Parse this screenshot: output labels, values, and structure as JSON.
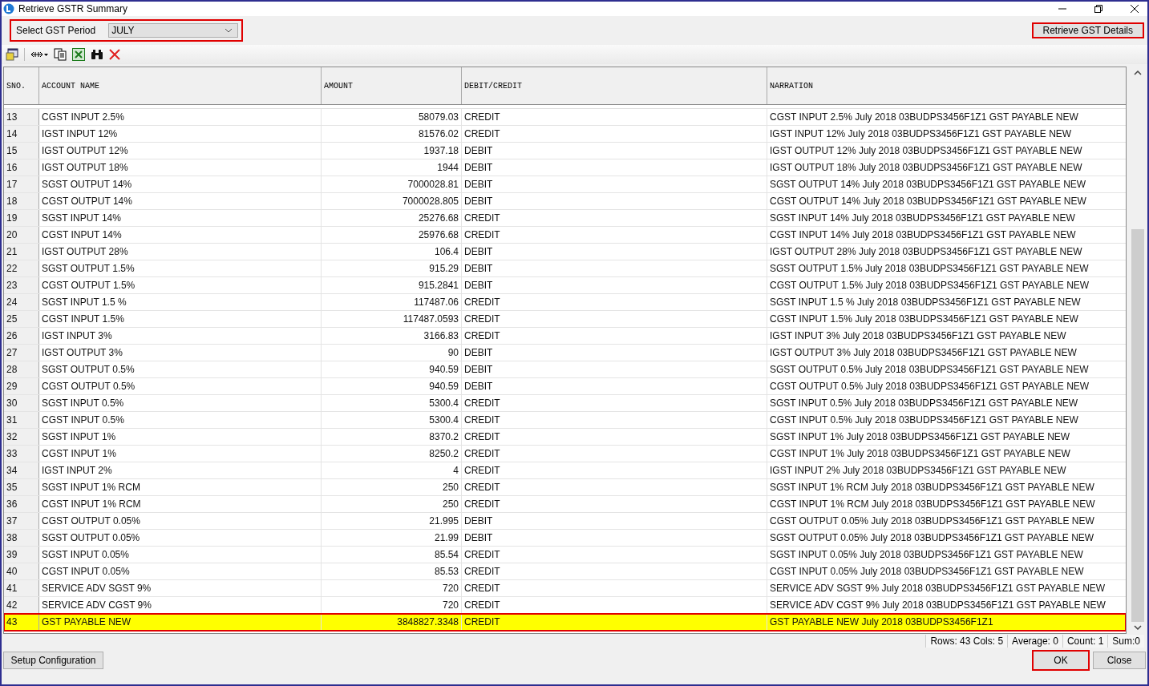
{
  "window": {
    "title": "Retrieve GSTR Summary"
  },
  "period": {
    "label": "Select GST Period",
    "value": "JULY",
    "highlighted": true
  },
  "retrieve_button": {
    "label": "Retrieve GST Details",
    "highlighted": true
  },
  "table": {
    "columns": [
      "SNO.",
      "ACCOUNT NAME",
      "AMOUNT",
      "DEBIT/CREDIT",
      "NARRATION"
    ],
    "rows": [
      {
        "sno": "13",
        "account": "CGST INPUT 2.5%",
        "amount": "58079.03",
        "dc": "CREDIT",
        "narration": "CGST INPUT 2.5% July 2018 03BUDPS3456F1Z1 GST PAYABLE NEW",
        "selected": false,
        "highlighted": false
      },
      {
        "sno": "14",
        "account": "IGST INPUT 12%",
        "amount": "81576.02",
        "dc": "CREDIT",
        "narration": "IGST INPUT 12% July 2018 03BUDPS3456F1Z1 GST PAYABLE NEW",
        "selected": false,
        "highlighted": false
      },
      {
        "sno": "15",
        "account": "IGST OUTPUT 12%",
        "amount": "1937.18",
        "dc": "DEBIT",
        "narration": "IGST OUTPUT 12% July 2018 03BUDPS3456F1Z1 GST PAYABLE NEW",
        "selected": false,
        "highlighted": false
      },
      {
        "sno": "16",
        "account": "IGST OUTPUT 18%",
        "amount": "1944",
        "dc": "DEBIT",
        "narration": "IGST OUTPUT 18% July 2018 03BUDPS3456F1Z1 GST PAYABLE NEW",
        "selected": false,
        "highlighted": false
      },
      {
        "sno": "17",
        "account": "SGST OUTPUT 14%",
        "amount": "7000028.81",
        "dc": "DEBIT",
        "narration": "SGST OUTPUT 14% July 2018 03BUDPS3456F1Z1 GST PAYABLE NEW",
        "selected": false,
        "highlighted": false
      },
      {
        "sno": "18",
        "account": "CGST OUTPUT 14%",
        "amount": "7000028.805",
        "dc": "DEBIT",
        "narration": "CGST OUTPUT 14% July 2018 03BUDPS3456F1Z1 GST PAYABLE NEW",
        "selected": false,
        "highlighted": false
      },
      {
        "sno": "19",
        "account": "SGST INPUT 14%",
        "amount": "25276.68",
        "dc": "CREDIT",
        "narration": "SGST INPUT 14% July 2018 03BUDPS3456F1Z1 GST PAYABLE NEW",
        "selected": false,
        "highlighted": false
      },
      {
        "sno": "20",
        "account": "CGST INPUT 14%",
        "amount": "25976.68",
        "dc": "CREDIT",
        "narration": "CGST INPUT 14% July 2018 03BUDPS3456F1Z1 GST PAYABLE NEW",
        "selected": false,
        "highlighted": false
      },
      {
        "sno": "21",
        "account": "IGST OUTPUT 28%",
        "amount": "106.4",
        "dc": "DEBIT",
        "narration": "IGST OUTPUT 28% July 2018 03BUDPS3456F1Z1 GST PAYABLE NEW",
        "selected": false,
        "highlighted": false
      },
      {
        "sno": "22",
        "account": "SGST OUTPUT 1.5%",
        "amount": "915.29",
        "dc": "DEBIT",
        "narration": "SGST OUTPUT 1.5% July 2018 03BUDPS3456F1Z1 GST PAYABLE NEW",
        "selected": false,
        "highlighted": false
      },
      {
        "sno": "23",
        "account": "CGST OUTPUT 1.5%",
        "amount": "915.2841",
        "dc": "DEBIT",
        "narration": "CGST OUTPUT 1.5% July 2018 03BUDPS3456F1Z1 GST PAYABLE NEW",
        "selected": false,
        "highlighted": false
      },
      {
        "sno": "24",
        "account": "SGST INPUT 1.5 %",
        "amount": "117487.06",
        "dc": "CREDIT",
        "narration": "SGST INPUT 1.5 % July 2018 03BUDPS3456F1Z1 GST PAYABLE NEW",
        "selected": false,
        "highlighted": false
      },
      {
        "sno": "25",
        "account": "CGST INPUT 1.5%",
        "amount": "117487.0593",
        "dc": "CREDIT",
        "narration": "CGST INPUT 1.5% July 2018 03BUDPS3456F1Z1 GST PAYABLE NEW",
        "selected": false,
        "highlighted": false
      },
      {
        "sno": "26",
        "account": "IGST INPUT 3%",
        "amount": "3166.83",
        "dc": "CREDIT",
        "narration": "IGST INPUT 3% July 2018 03BUDPS3456F1Z1 GST PAYABLE NEW",
        "selected": false,
        "highlighted": false
      },
      {
        "sno": "27",
        "account": "IGST OUTPUT 3%",
        "amount": "90",
        "dc": "DEBIT",
        "narration": "IGST OUTPUT 3% July 2018 03BUDPS3456F1Z1 GST PAYABLE NEW",
        "selected": false,
        "highlighted": false
      },
      {
        "sno": "28",
        "account": "SGST OUTPUT 0.5%",
        "amount": "940.59",
        "dc": "DEBIT",
        "narration": "SGST OUTPUT 0.5% July 2018 03BUDPS3456F1Z1 GST PAYABLE NEW",
        "selected": false,
        "highlighted": false
      },
      {
        "sno": "29",
        "account": "CGST OUTPUT 0.5%",
        "amount": "940.59",
        "dc": "DEBIT",
        "narration": "CGST OUTPUT 0.5% July 2018 03BUDPS3456F1Z1 GST PAYABLE NEW",
        "selected": false,
        "highlighted": false
      },
      {
        "sno": "30",
        "account": "SGST INPUT 0.5%",
        "amount": "5300.4",
        "dc": "CREDIT",
        "narration": "SGST INPUT 0.5% July 2018 03BUDPS3456F1Z1 GST PAYABLE NEW",
        "selected": false,
        "highlighted": false
      },
      {
        "sno": "31",
        "account": "CGST INPUT 0.5%",
        "amount": "5300.4",
        "dc": "CREDIT",
        "narration": "CGST INPUT 0.5% July 2018 03BUDPS3456F1Z1 GST PAYABLE NEW",
        "selected": false,
        "highlighted": false
      },
      {
        "sno": "32",
        "account": "SGST INPUT 1%",
        "amount": "8370.2",
        "dc": "CREDIT",
        "narration": "SGST INPUT 1% July 2018 03BUDPS3456F1Z1 GST PAYABLE NEW",
        "selected": false,
        "highlighted": false
      },
      {
        "sno": "33",
        "account": "CGST INPUT 1%",
        "amount": "8250.2",
        "dc": "CREDIT",
        "narration": "CGST INPUT 1% July 2018 03BUDPS3456F1Z1 GST PAYABLE NEW",
        "selected": false,
        "highlighted": false
      },
      {
        "sno": "34",
        "account": "IGST INPUT 2%",
        "amount": "4",
        "dc": "CREDIT",
        "narration": "IGST INPUT 2% July 2018 03BUDPS3456F1Z1 GST PAYABLE NEW",
        "selected": false,
        "highlighted": false
      },
      {
        "sno": "35",
        "account": "SGST INPUT 1% RCM",
        "amount": "250",
        "dc": "CREDIT",
        "narration": "SGST INPUT 1% RCM July 2018 03BUDPS3456F1Z1 GST PAYABLE NEW",
        "selected": false,
        "highlighted": false
      },
      {
        "sno": "36",
        "account": "CGST INPUT 1% RCM",
        "amount": "250",
        "dc": "CREDIT",
        "narration": "CGST INPUT 1% RCM July 2018 03BUDPS3456F1Z1 GST PAYABLE NEW",
        "selected": false,
        "highlighted": false
      },
      {
        "sno": "37",
        "account": "CGST OUTPUT 0.05%",
        "amount": "21.995",
        "dc": "DEBIT",
        "narration": "CGST OUTPUT 0.05% July 2018 03BUDPS3456F1Z1 GST PAYABLE NEW",
        "selected": false,
        "highlighted": false
      },
      {
        "sno": "38",
        "account": "SGST OUTPUT 0.05%",
        "amount": "21.99",
        "dc": "DEBIT",
        "narration": "SGST OUTPUT 0.05% July 2018 03BUDPS3456F1Z1 GST PAYABLE NEW",
        "selected": false,
        "highlighted": false
      },
      {
        "sno": "39",
        "account": "SGST INPUT 0.05%",
        "amount": "85.54",
        "dc": "CREDIT",
        "narration": "SGST INPUT 0.05% July 2018 03BUDPS3456F1Z1 GST PAYABLE NEW",
        "selected": false,
        "highlighted": false
      },
      {
        "sno": "40",
        "account": "CGST INPUT 0.05%",
        "amount": "85.53",
        "dc": "CREDIT",
        "narration": "CGST INPUT 0.05% July 2018 03BUDPS3456F1Z1 GST PAYABLE NEW",
        "selected": false,
        "highlighted": false
      },
      {
        "sno": "41",
        "account": "SERVICE ADV SGST 9%",
        "amount": "720",
        "dc": "CREDIT",
        "narration": "SERVICE ADV SGST 9% July 2018 03BUDPS3456F1Z1 GST PAYABLE NEW",
        "selected": false,
        "highlighted": false
      },
      {
        "sno": "42",
        "account": "SERVICE ADV CGST 9%",
        "amount": "720",
        "dc": "CREDIT",
        "narration": "SERVICE ADV CGST 9% July 2018 03BUDPS3456F1Z1 GST PAYABLE NEW",
        "selected": false,
        "highlighted": false
      },
      {
        "sno": "43",
        "account": "GST PAYABLE NEW",
        "amount": "3848827.3348",
        "dc": "CREDIT",
        "narration": "GST PAYABLE NEW July 2018 03BUDPS3456F1Z1",
        "selected": true,
        "highlighted": true
      }
    ]
  },
  "status_bar": [
    "Rows: 43  Cols: 5",
    "Average: 0",
    "Count: 1",
    "Sum:0"
  ],
  "setup_button": {
    "label": "Setup Configuration"
  },
  "ok_button": {
    "label": "OK",
    "highlighted": true
  },
  "close_button": {
    "label": "Close"
  }
}
